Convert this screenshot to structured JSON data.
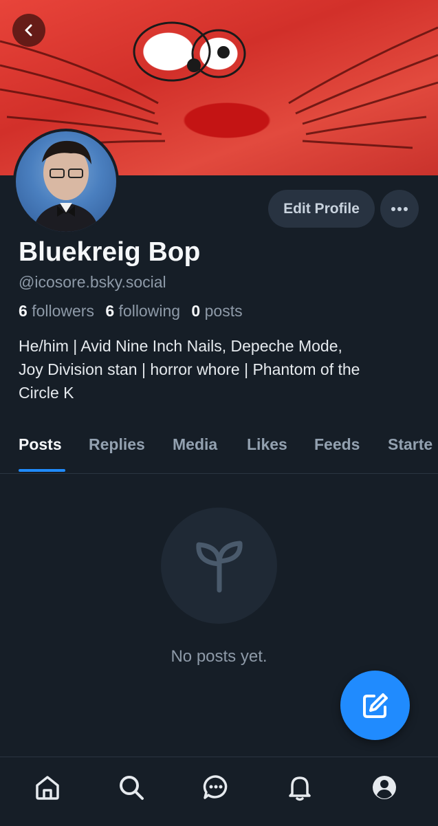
{
  "profile": {
    "display_name": "Bluekreig Bop",
    "handle": "@icosore.bsky.social",
    "followers_count": "6",
    "followers_label": "followers",
    "following_count": "6",
    "following_label": "following",
    "posts_count": "0",
    "posts_label": "posts",
    "bio_lines": [
      "He/him | Avid Nine Inch Nails, Depeche Mode,",
      "Joy Division stan | horror whore | Phantom of the",
      "Circle K"
    ]
  },
  "actions": {
    "edit_profile_label": "Edit Profile",
    "more_icon": "ellipsis-icon",
    "back_icon": "chevron-left-icon"
  },
  "tabs": [
    {
      "label": "Posts",
      "active": true
    },
    {
      "label": "Replies",
      "active": false
    },
    {
      "label": "Media",
      "active": false
    },
    {
      "label": "Likes",
      "active": false
    },
    {
      "label": "Feeds",
      "active": false
    },
    {
      "label": "Starte",
      "active": false
    }
  ],
  "empty_state": {
    "icon": "sprout-icon",
    "text": "No posts yet."
  },
  "fab": {
    "icon": "compose-icon"
  },
  "bottom_nav": [
    {
      "icon": "home-icon"
    },
    {
      "icon": "search-icon"
    },
    {
      "icon": "chat-icon"
    },
    {
      "icon": "bell-icon"
    },
    {
      "icon": "profile-icon"
    }
  ],
  "colors": {
    "background": "#161e27",
    "accent": "#208bfe",
    "muted_text": "#8e9aa8",
    "button_bg": "#283341"
  }
}
